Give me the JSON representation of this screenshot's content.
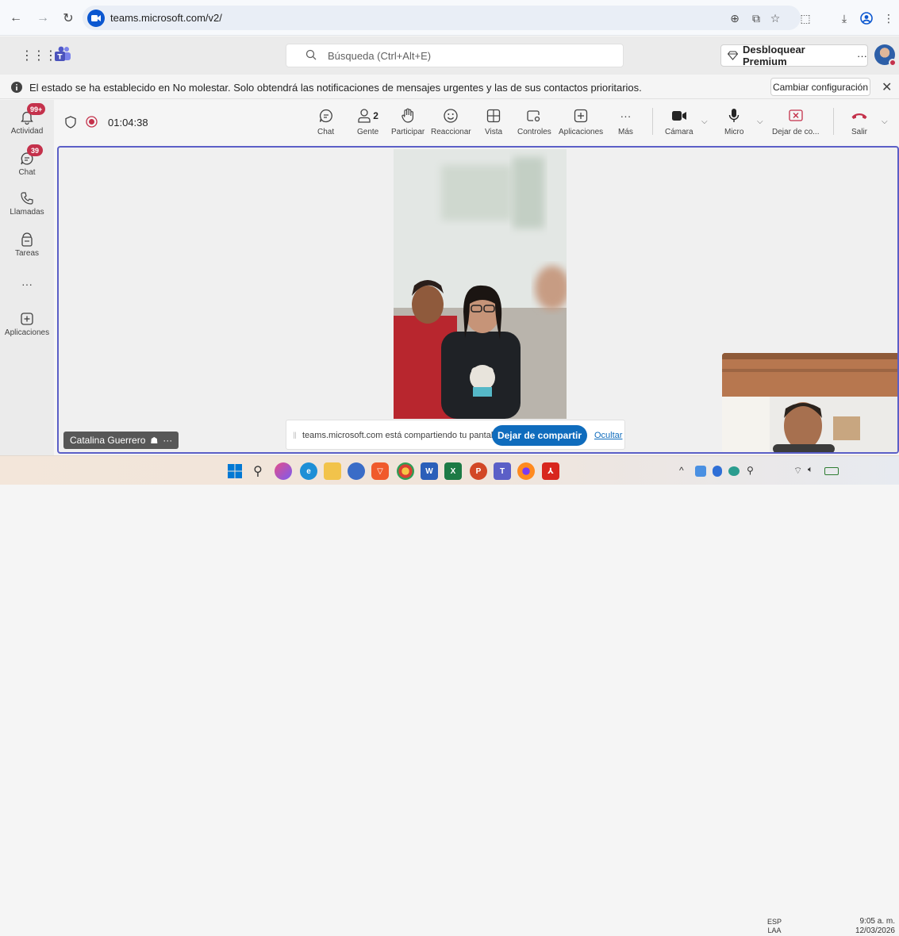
{
  "browser": {
    "url": "teams.microsoft.com/v2/"
  },
  "teams": {
    "search_placeholder": "Búsqueda (Ctrl+Alt+E)",
    "premium_label": "Desbloquear Premium",
    "more_label": "···"
  },
  "notice": {
    "text": "El estado se ha establecido en No molestar. Solo obtendrá las notificaciones de mensajes urgentes y las de sus contactos prioritarios.",
    "change_label": "Cambiar configuración"
  },
  "rail": {
    "items": [
      {
        "label": "Actividad",
        "badge": "99+",
        "icon": "bell-icon"
      },
      {
        "label": "Chat",
        "badge": "39",
        "icon": "chat-icon"
      },
      {
        "label": "Llamadas",
        "badge": "",
        "icon": "phone-icon"
      },
      {
        "label": "Tareas",
        "badge": "",
        "icon": "tasks-icon"
      },
      {
        "label": "",
        "badge": "",
        "icon": "more-icon"
      },
      {
        "label": "Aplicaciones",
        "badge": "",
        "icon": "add-apps-icon"
      }
    ]
  },
  "meeting": {
    "timer": "01:04:38",
    "people_count": "2",
    "tools": [
      {
        "label": "Chat"
      },
      {
        "label": "Gente"
      },
      {
        "label": "Participar"
      },
      {
        "label": "Reaccionar"
      },
      {
        "label": "Vista"
      },
      {
        "label": "Controles"
      },
      {
        "label": "Aplicaciones"
      },
      {
        "label": "Más"
      },
      {
        "label": "Cámara"
      },
      {
        "label": "Micro"
      },
      {
        "label": "Dejar de co..."
      },
      {
        "label": "Salir"
      }
    ]
  },
  "stage": {
    "participant_name": "Catalina Guerrero",
    "share_text": "teams.microsoft.com está compartiendo tu pantalla.",
    "stop_share_label": "Dejar de compartir",
    "hide_label": "Ocultar"
  },
  "taskbar": {
    "lang_top": "ESP",
    "lang_bottom": "LAA",
    "time": "9:05 a. m.",
    "date": "12/03/2026"
  },
  "colors": {
    "accent": "#5b5fc7",
    "badge": "#c4314b",
    "primary_button": "#0f6cbd",
    "leave": "#c4314b"
  }
}
